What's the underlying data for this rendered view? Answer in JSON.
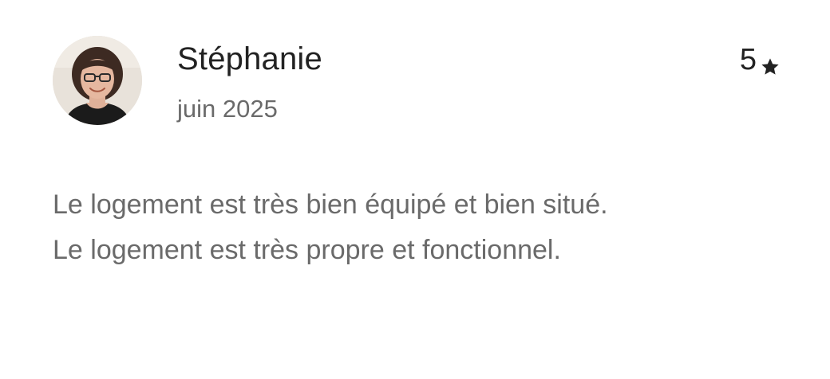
{
  "review": {
    "reviewer_name": "Stéphanie",
    "date": "juin 2025",
    "rating": "5",
    "rating_icon": "star-icon",
    "text_lines": [
      "Le logement est très bien équipé et bien situé.",
      "Le logement est très propre et fonctionnel."
    ]
  },
  "colors": {
    "name": "#222222",
    "secondary_text": "#6a6a6a",
    "background": "#ffffff"
  }
}
